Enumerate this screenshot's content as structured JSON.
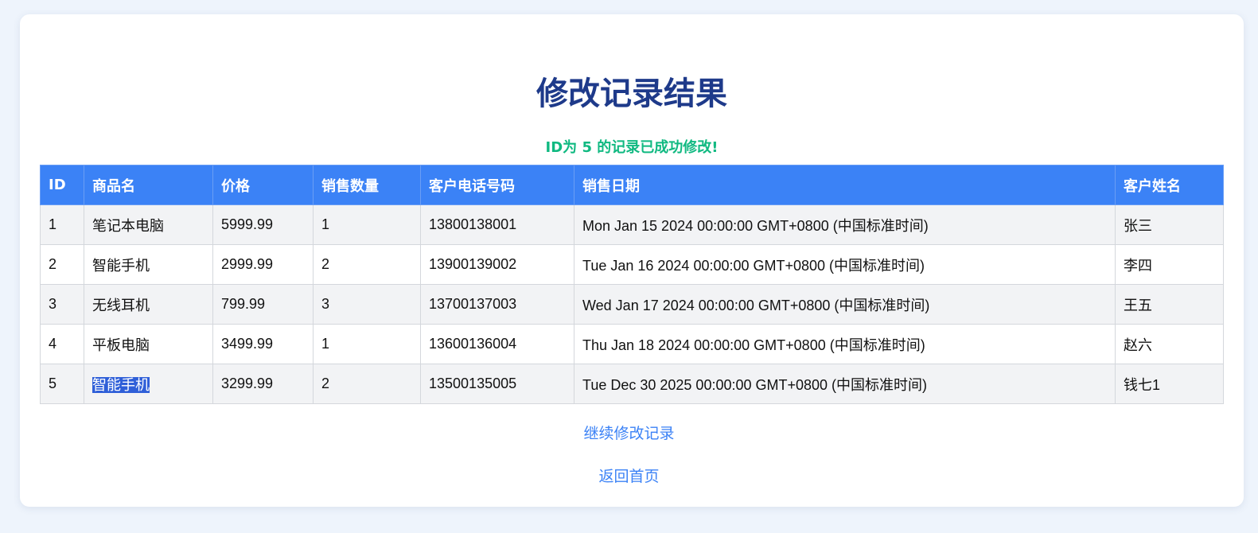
{
  "page": {
    "title": "修改记录结果",
    "success_message": "ID为 5 的记录已成功修改!"
  },
  "table": {
    "headers": [
      "ID",
      "商品名",
      "价格",
      "销售数量",
      "客户电话号码",
      "销售日期",
      "客户姓名"
    ],
    "rows": [
      [
        "1",
        "笔记本电脑",
        "5999.99",
        "1",
        "13800138001",
        "Mon Jan 15 2024 00:00:00 GMT+0800 (中国标准时间)",
        "张三"
      ],
      [
        "2",
        "智能手机",
        "2999.99",
        "2",
        "13900139002",
        "Tue Jan 16 2024 00:00:00 GMT+0800 (中国标准时间)",
        "李四"
      ],
      [
        "3",
        "无线耳机",
        "799.99",
        "3",
        "13700137003",
        "Wed Jan 17 2024 00:00:00 GMT+0800 (中国标准时间)",
        "王五"
      ],
      [
        "4",
        "平板电脑",
        "3499.99",
        "1",
        "13600136004",
        "Thu Jan 18 2024 00:00:00 GMT+0800 (中国标准时间)",
        "赵六"
      ],
      [
        "5",
        "智能手机",
        "3299.99",
        "2",
        "13500135005",
        "Tue Dec 30 2025 00:00:00 GMT+0800 (中国标准时间)",
        "钱七1"
      ]
    ]
  },
  "links": {
    "continue_edit": "继续修改记录",
    "back_home": "返回首页"
  },
  "colors": {
    "title": "#1e3a8a",
    "success": "#10b981",
    "header_bg": "#3b82f6",
    "link": "#3b82f6",
    "selection": "#2f5fd8"
  }
}
